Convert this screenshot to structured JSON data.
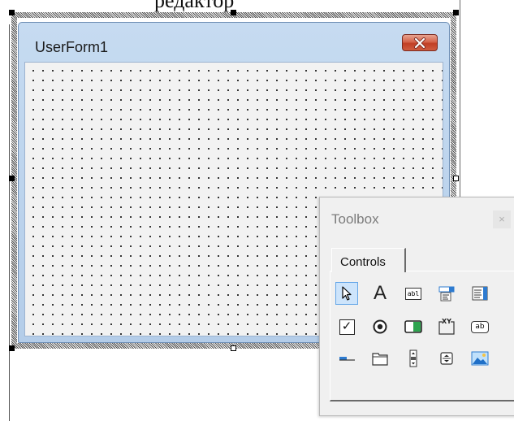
{
  "top_caption": "редактор",
  "userform": {
    "title": "UserForm1",
    "close_glyph": "✕"
  },
  "toolbox": {
    "title": "Toolbox",
    "close_glyph": "×",
    "tab_label": "Controls",
    "tools": [
      {
        "name": "select-objects",
        "icon": "pointer-arrow-icon",
        "selected": true
      },
      {
        "name": "label",
        "icon": "label-A-icon",
        "glyph": "A"
      },
      {
        "name": "textbox",
        "icon": "textbox-abl-icon",
        "glyph": "abl"
      },
      {
        "name": "combobox",
        "icon": "combobox-icon"
      },
      {
        "name": "listbox",
        "icon": "listbox-icon"
      },
      {
        "name": "checkbox",
        "icon": "checkbox-icon",
        "glyph": "✓"
      },
      {
        "name": "optionbutton",
        "icon": "radio-button-icon"
      },
      {
        "name": "togglebutton",
        "icon": "toggle-button-icon"
      },
      {
        "name": "frame",
        "icon": "frame-xy-icon",
        "glyph": "XY"
      },
      {
        "name": "commandbutton",
        "icon": "command-button-ab-icon",
        "glyph": "ab"
      },
      {
        "name": "tabstrip",
        "icon": "tabstrip-icon"
      },
      {
        "name": "multipage",
        "icon": "multipage-icon"
      },
      {
        "name": "scrollbar",
        "icon": "scrollbar-icon"
      },
      {
        "name": "spinbutton",
        "icon": "spin-button-icon"
      },
      {
        "name": "image",
        "icon": "image-icon"
      }
    ]
  },
  "colors": {
    "form_frame": "#c6dbf1",
    "form_client": "#f2f2f2",
    "close_red": "#c13f25",
    "toolbox_bg": "#f0f0f0",
    "selected_tool": "#cde4fb"
  }
}
